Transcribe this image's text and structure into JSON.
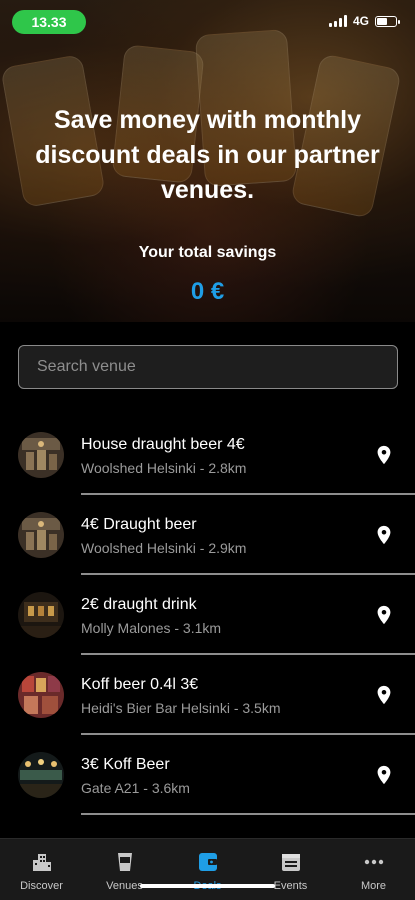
{
  "status_bar": {
    "time": "13.33",
    "network": "4G"
  },
  "hero": {
    "title": "Save money with monthly discount deals in our partner venues.",
    "savings_label": "Your total savings",
    "savings_value": "0 €"
  },
  "search": {
    "placeholder": "Search venue",
    "value": ""
  },
  "deals": [
    {
      "title": "House draught beer 4€",
      "subtitle": "Woolshed Helsinki - 2.8km",
      "avatar_icon": "woolshed-venue-photo"
    },
    {
      "title": "4€ Draught beer",
      "subtitle": "Woolshed Helsinki - 2.9km",
      "avatar_icon": "woolshed-venue-photo"
    },
    {
      "title": "2€ draught drink",
      "subtitle": "Molly Malones - 3.1km",
      "avatar_icon": "molly-malones-venue-photo"
    },
    {
      "title": "Koff beer 0.4l 3€",
      "subtitle": "Heidi's Bier Bar Helsinki - 3.5km",
      "avatar_icon": "heidis-venue-photo"
    },
    {
      "title": "3€ Koff Beer",
      "subtitle": "Gate A21 - 3.6km",
      "avatar_icon": "gate-a21-venue-photo"
    }
  ],
  "tabs": [
    {
      "label": "Discover",
      "icon": "city-icon",
      "active": false
    },
    {
      "label": "Venues",
      "icon": "cup-icon",
      "active": false
    },
    {
      "label": "Deals",
      "icon": "wallet-icon",
      "active": true
    },
    {
      "label": "Events",
      "icon": "calendar-icon",
      "active": false
    },
    {
      "label": "More",
      "icon": "more-dots-icon",
      "active": false
    }
  ],
  "colors": {
    "accent": "#1f9ee6",
    "time_pill": "#2fc64a",
    "background": "#000000",
    "tab_bar": "#1a1a1a"
  }
}
